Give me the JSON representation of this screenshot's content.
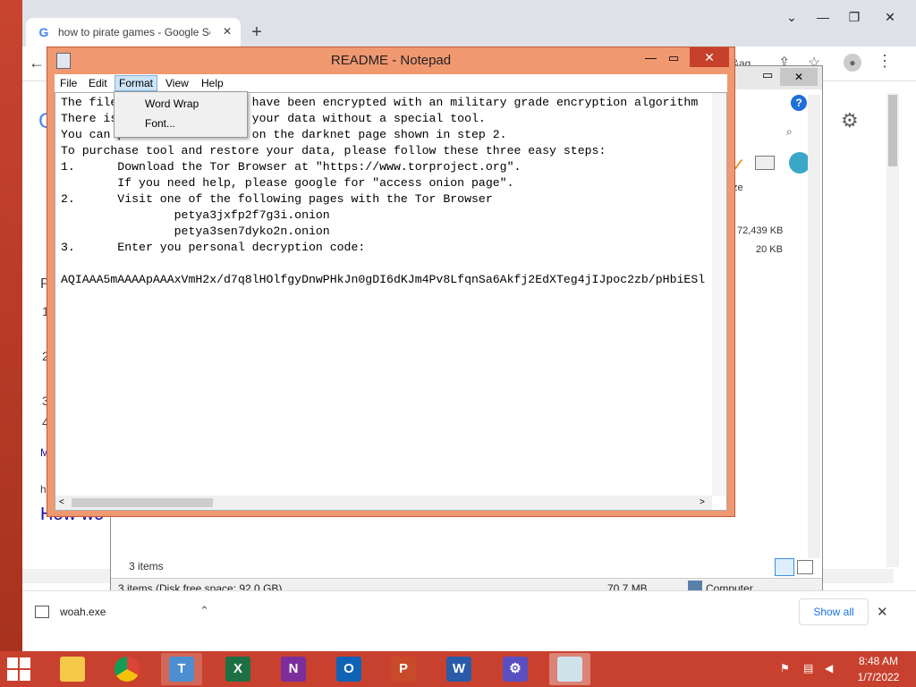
{
  "browser": {
    "tab_title": "how to pirate games - Google Se",
    "close_tab": "✕",
    "new_tab": "+",
    "url_suffix": "&aq",
    "result_heading_partial": "How wo",
    "page_letters": [
      "P",
      "1",
      "2",
      "3",
      "4",
      "M",
      "h"
    ]
  },
  "download_bar": {
    "filename": "woah.exe",
    "show_all": "Show all"
  },
  "explorer": {
    "size_header": "ze",
    "sizes": [
      "72,439 KB",
      "20 KB"
    ],
    "items_count": "3 items",
    "status_items": "3 items (Disk free space: 92.0 GB)",
    "status_size": "70.7 MB",
    "status_location": "Computer"
  },
  "notepad": {
    "title": "README - Notepad",
    "menu": [
      "File",
      "Edit",
      "Format",
      "View",
      "Help"
    ],
    "format_menu": [
      "Word Wrap",
      "Font..."
    ],
    "lines": [
      "The files on your computer have been encrypted with an military grade encryption algorithm",
      "There is no way to restore your data without a special tool.",
      "You can purchase this tool on the darknet page shown in step 2.",
      "To purchase tool and restore your data, please follow these three easy steps:",
      "1.      Download the Tor Browser at \"https://www.torproject.org\".",
      "        If you need help, please google for \"access onion page\".",
      "2.      Visit one of the following pages with the Tor Browser",
      "                petya3jxfp2f7g3i.onion",
      "                petya3sen7dyko2n.onion",
      "3.      Enter you personal decryption code:",
      "",
      "AQIAAA5mAAAApAAAxVmH2x/d7q8lHOlfgyDnwPHkJn0gDI6dKJm4Pv8LfqnSa6Akfj2EdXTeg4jIJpoc2zb/pHbiESl"
    ]
  },
  "taskbar": {
    "apps": [
      "file-explorer",
      "chrome",
      "teams",
      "excel",
      "onenote",
      "outlook",
      "powerpoint",
      "word",
      "settings",
      "notepad"
    ],
    "time": "8:48 AM",
    "date": "1/7/2022"
  },
  "colors": {
    "desktop": "#c8442f",
    "notepad_frame": "#f09870",
    "taskbar": "#c8412e"
  }
}
